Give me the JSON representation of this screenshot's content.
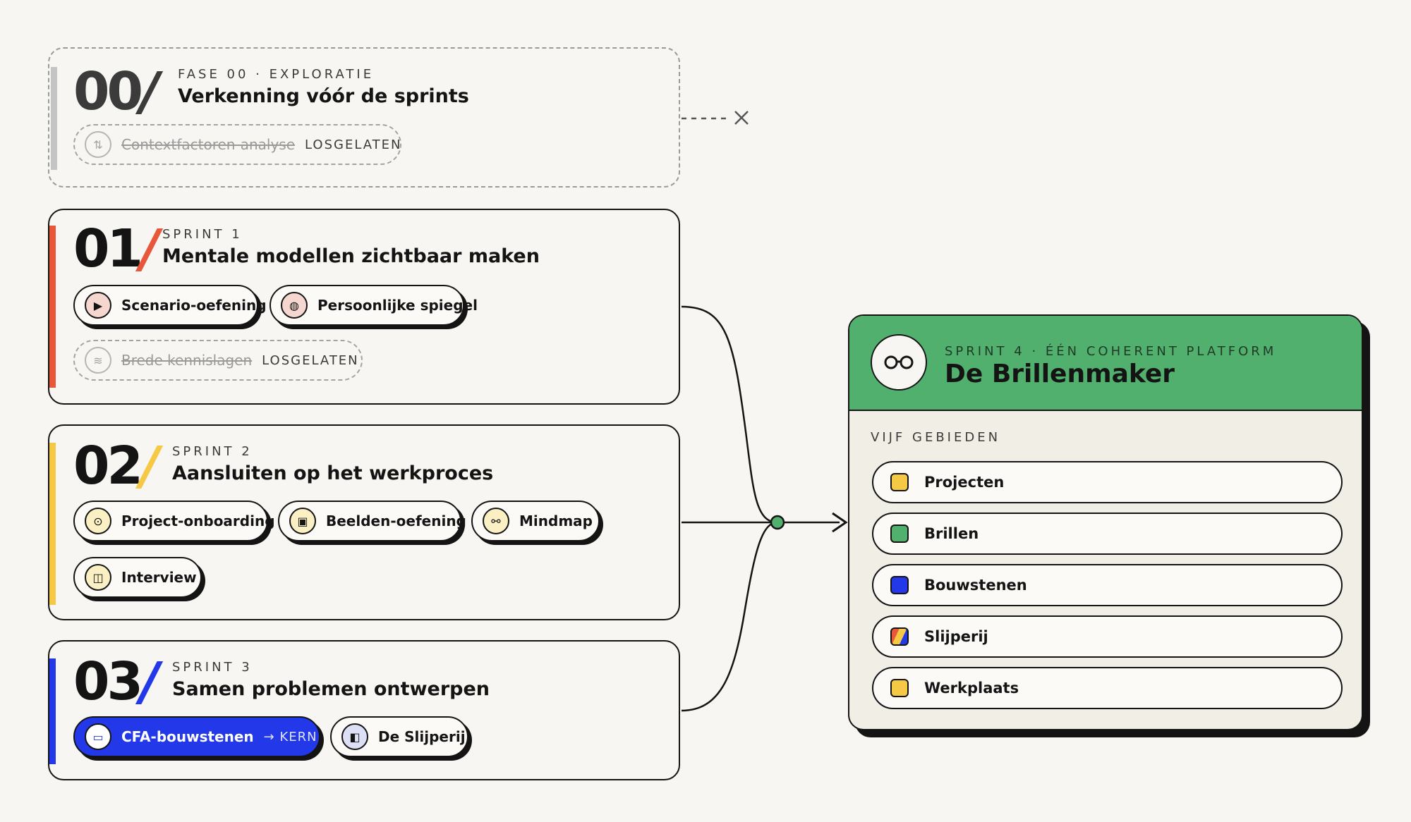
{
  "phase0": {
    "number": "00",
    "slash": "/",
    "kicker": "FASE 00 · EXPLORATIE",
    "title": "Verkenning vóór de sprints",
    "items": [
      {
        "label": "Contextfactoren-analyse",
        "tag": "LOSGELATEN",
        "icon": "arrows-icon"
      }
    ]
  },
  "sprints": [
    {
      "number": "01",
      "slash": "/",
      "kicker": "SPRINT 1",
      "title": "Mentale modellen zichtbaar maken",
      "accent": "#e8573a",
      "items": [
        {
          "label": "Scenario-oefening",
          "icon": "play-icon",
          "icon_color": "#f6d7d0"
        },
        {
          "label": "Persoonlijke spiegel",
          "icon": "mirror-icon",
          "icon_color": "#f6d7d0"
        }
      ],
      "dropped": [
        {
          "label": "Brede kennislagen",
          "tag": "LOSGELATEN",
          "icon": "layers-icon"
        }
      ]
    },
    {
      "number": "02",
      "slash": "/",
      "kicker": "SPRINT 2",
      "title": "Aansluiten op het werkproces",
      "accent": "#f6c944",
      "items": [
        {
          "label": "Project-onboarding",
          "icon": "pin-icon",
          "icon_color": "#fbefc4"
        },
        {
          "label": "Beelden-oefening",
          "icon": "image-icon",
          "icon_color": "#fbefc4"
        },
        {
          "label": "Mindmap",
          "icon": "mindmap-icon",
          "icon_color": "#fbefc4"
        },
        {
          "label": "Interview",
          "icon": "chat-icon",
          "icon_color": "#fbefc4"
        }
      ]
    },
    {
      "number": "03",
      "slash": "/",
      "kicker": "SPRINT 3",
      "title": "Samen problemen ontwerpen",
      "accent": "#2338e8",
      "items": [
        {
          "label": "CFA-bouwstenen",
          "extra": "→ KERN",
          "icon": "blocks-icon",
          "core": true
        },
        {
          "label": "De Slijperij",
          "icon": "book-icon",
          "icon_color": "#dcdff5"
        }
      ]
    }
  ],
  "platform": {
    "kicker": "SPRINT 4 · ÉÉN COHERENT PLATFORM",
    "title": "De Brillenmaker",
    "logo_icon": "glasses-icon",
    "header_color": "#52b06e",
    "areas_title": "VIJF GEBIEDEN",
    "areas": [
      {
        "label": "Projecten",
        "color": "#f6c944"
      },
      {
        "label": "Brillen",
        "color": "#52b06e"
      },
      {
        "label": "Bouwstenen",
        "color": "#2338e8"
      },
      {
        "label": "Slijperij",
        "color": "multicolor"
      },
      {
        "label": "Werkplaats",
        "color": "#f6c944"
      }
    ]
  }
}
